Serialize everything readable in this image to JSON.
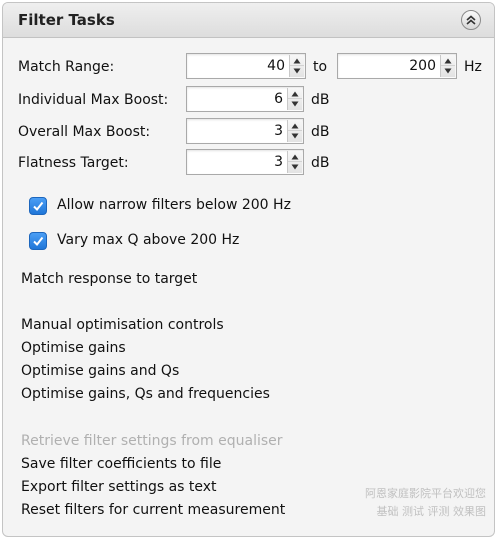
{
  "panel": {
    "title": "Filter Tasks",
    "collapse_icon": "double-chevron-up-icon"
  },
  "fields": {
    "match_range_label": "Match Range:",
    "match_range_from": "40",
    "match_range_to_word": "to",
    "match_range_to": "200",
    "match_range_unit": "Hz",
    "individual_max_boost_label": "Individual Max Boost:",
    "individual_max_boost": "6",
    "individual_max_boost_unit": "dB",
    "overall_max_boost_label": "Overall Max Boost:",
    "overall_max_boost": "3",
    "overall_max_boost_unit": "dB",
    "flatness_target_label": "Flatness Target:",
    "flatness_target": "3",
    "flatness_target_unit": "dB"
  },
  "checkboxes": [
    {
      "label": "Allow narrow filters below 200 Hz",
      "checked": true
    },
    {
      "label": "Vary max Q above 200 Hz",
      "checked": true
    }
  ],
  "actions": {
    "match_response": "Match response to target",
    "manual_controls": "Manual optimisation controls",
    "optimise_gains": "Optimise gains",
    "optimise_gains_qs": "Optimise gains and Qs",
    "optimise_gains_qs_freqs": "Optimise gains, Qs and frequencies",
    "retrieve_settings": "Retrieve filter settings from equaliser",
    "save_coefficients": "Save filter coefficients to file",
    "export_settings": "Export filter settings as text",
    "reset_filters": "Reset filters for current measurement"
  },
  "watermark": {
    "line1": "阿恩家庭影院平台欢迎您",
    "line2": "基础 测试 评测 效果图"
  },
  "colors": {
    "checkbox_accent": "#1f76d8",
    "disabled_text": "#b0b0b0",
    "panel_background": "#f4f4f4"
  }
}
